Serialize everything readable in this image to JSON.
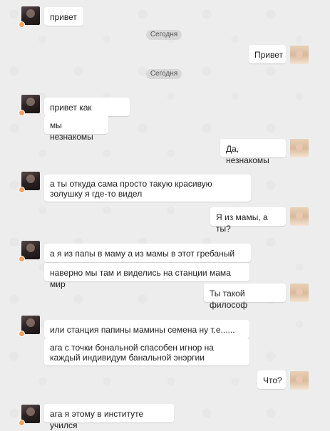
{
  "date_separators": [
    "Сегодня",
    "Сегодня"
  ],
  "messages": [
    {
      "side": "left",
      "text": "привет"
    },
    {
      "side": "right",
      "text": "Привет"
    },
    {
      "side": "left",
      "text": "привет как делишки"
    },
    {
      "side": "left",
      "text": "мы незнакомы"
    },
    {
      "side": "right",
      "text": "Да, незнакомы"
    },
    {
      "side": "left",
      "text": "а ты откуда сама просто такую красивую золушку я где-то видел"
    },
    {
      "side": "right",
      "text": "Я из мамы, а ты?"
    },
    {
      "side": "left",
      "text": "а я из папы в маму а из мамы в этот гребаный мир"
    },
    {
      "side": "left",
      "text": "наверно мы там и виделись на станции мама мир"
    },
    {
      "side": "right",
      "text": "Ты такой философ"
    },
    {
      "side": "left",
      "text": "или станция папины мамины семена ну т.е......"
    },
    {
      "side": "left",
      "text": "ага с точки бональной спасобен игнор на каждый индивидум банальной энэргии"
    },
    {
      "side": "right",
      "text": "Что?"
    },
    {
      "side": "left",
      "text": "ага я этому в институте учился"
    }
  ],
  "icons": {
    "left_avatar": "male-user-avatar",
    "right_avatar": "female-user-avatar",
    "status_dot": "online-status-badge"
  },
  "colors": {
    "background": "#ededed",
    "bubble": "#ffffff",
    "date_pill": "#d8d8d8",
    "status_dot": "#f5a05a"
  }
}
